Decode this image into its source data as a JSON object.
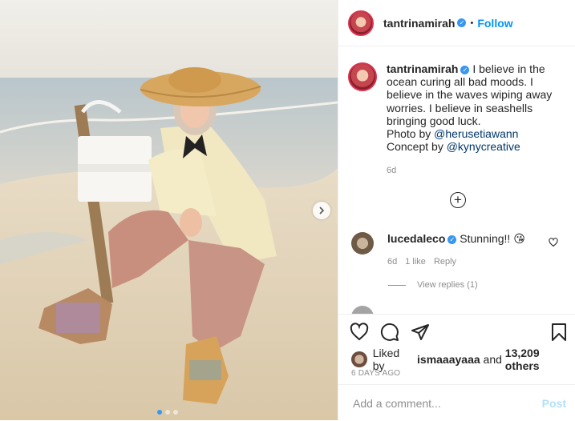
{
  "post": {
    "username": "tantrinamirah",
    "follow_label": "Follow",
    "header_sep": "•",
    "caption": "I believe in the ocean curing all bad moods. I believe in the waves wiping away worries. I believe in seashells bringing good luck.",
    "photo_by_prefix": "Photo by",
    "photographer": "@herusetiawann",
    "concept_by_prefix": "Concept by",
    "concept": "@kynycreative",
    "caption_age": "6d"
  },
  "comments": [
    {
      "username": "lucedaleco",
      "text": "Stunning!! 😘",
      "age": "6d",
      "likes": "1 like",
      "reply_label": "Reply",
      "view_replies": "View replies (1)"
    }
  ],
  "actions": {
    "liked_by_prefix": "Liked by",
    "liked_by_user": "ismaaayaaa",
    "liked_by_and": "and",
    "likes_count": "13,209 others",
    "date": "6 DAYS AGO"
  },
  "comment_input": {
    "placeholder": "Add a comment...",
    "post_label": "Post"
  },
  "colors": {
    "accent": "#0095f6",
    "verified": "#3897f0",
    "muted": "#8e8e8e",
    "post_disabled": "#b2dffc"
  },
  "icons": [
    "verified-icon",
    "add-comment-icon",
    "heart-icon",
    "comment-icon",
    "share-icon",
    "bookmark-icon",
    "next-arrow-icon"
  ]
}
